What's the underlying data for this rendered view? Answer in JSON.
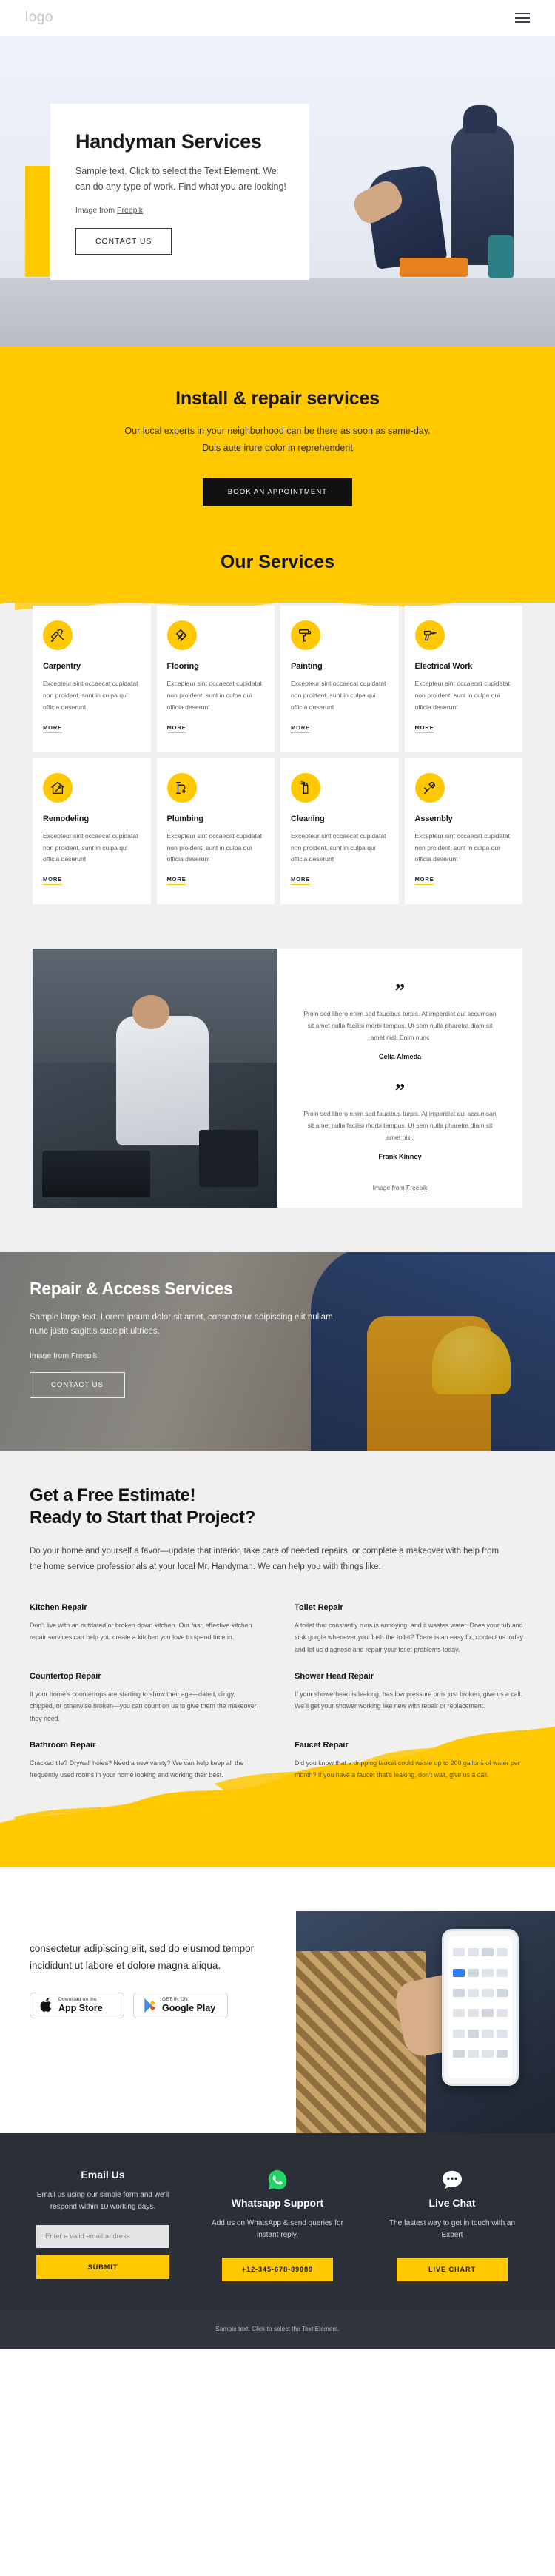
{
  "header": {
    "logo": "logo",
    "menu_icon": "hamburger-menu-icon"
  },
  "hero": {
    "title": "Handyman Services",
    "lead": "Sample text. Click to select the Text Element. We can do any type of work. Find what you are looking!",
    "credit_prefix": "Image from ",
    "credit_link": "Freepik",
    "cta": "CONTACT US"
  },
  "install": {
    "title": "Install & repair services",
    "text": "Our local experts in your neighborhood can be there as soon as same-day. Duis aute irure dolor in reprehenderit",
    "cta": "BOOK AN APPOINTMENT"
  },
  "services": {
    "title": "Our Services",
    "body": "Excepteur sint occaecat cupidatat non proident, sunt in culpa qui officia deserunt",
    "more": "MORE",
    "items": [
      {
        "title": "Carpentry",
        "icon": "saw-hammer-icon"
      },
      {
        "title": "Flooring",
        "icon": "parquet-floor-icon"
      },
      {
        "title": "Painting",
        "icon": "paint-roller-icon"
      },
      {
        "title": "Electrical Work",
        "icon": "power-drill-icon"
      },
      {
        "title": "Remodeling",
        "icon": "house-wrench-icon"
      },
      {
        "title": "Plumbing",
        "icon": "faucet-drip-icon"
      },
      {
        "title": "Cleaning",
        "icon": "spray-bottle-icon"
      },
      {
        "title": "Assembly",
        "icon": "screwdriver-wrench-icon"
      }
    ]
  },
  "testimonials": {
    "quote_mark": "”",
    "items": [
      {
        "text": "Proin sed libero enim sed faucibus turpis. At imperdiet dui accumsan sit amet nulla facilisi morbi tempus. Ut sem nulla pharetra diam sit amet nisl. Enim nunc",
        "author": "Celia Almeda"
      },
      {
        "text": "Proin sed libero enim sed faucibus turpis. At imperdiet dui accumsan sit amet nulla facilisi morbi tempus. Ut sem nulla pharetra diam sit amet nisl.",
        "author": "Frank Kinney"
      }
    ],
    "credit_prefix": "Image from ",
    "credit_link": "Freepik"
  },
  "repair": {
    "title": "Repair & Access Services",
    "text": "Sample large text. Lorem ipsum dolor sit amet, consectetur adipiscing elit nullam nunc justo sagittis suscipit ultrices.",
    "credit_prefix": "Image from ",
    "credit_link": "Freepik",
    "cta": "CONTACT US"
  },
  "estimate": {
    "title_line1": "Get a Free Estimate!",
    "title_line2": "Ready to Start that Project?",
    "intro": "Do your home and yourself a favor—update that interior, take care of needed repairs, or complete a makeover with help from the home service professionals at your local Mr. Handyman. We can help you with things like:",
    "items": [
      {
        "title": "Kitchen Repair",
        "text": "Don’t live with an outdated or broken down kitchen. Our fast, effective kitchen repair services can help you create a kitchen you love to spend time in."
      },
      {
        "title": "Toilet Repair",
        "text": "A toilet that constantly runs is annoying, and it wastes water. Does your tub and sink gurgle whenever you flush the toilet? There is an easy fix, contact us today and let us diagnose and repair your toilet problems today."
      },
      {
        "title": "Countertop Repair",
        "text": "If your home’s countertops are starting to show their age—dated, dingy, chipped, or otherwise broken—you can count on us to give them the makeover they need."
      },
      {
        "title": "Shower Head Repair",
        "text": "If your showerhead is leaking, has low pressure or is just broken, give us a call. We’ll get your shower working like new with repair or replacement."
      },
      {
        "title": "Bathroom Repair",
        "text": "Cracked tile? Drywall holes? Need a new vanity? We can help keep all the frequently used rooms in your home looking and working their best."
      },
      {
        "title": "Faucet Repair",
        "text": "Did you know that a dripping faucet could waste up to 200 gallons of water per month? If you have a faucet that’s leaking, don’t wait, give us a call."
      }
    ]
  },
  "app": {
    "text": "consectetur adipiscing elit, sed do eiusmod tempor incididunt ut labore et dolore magna aliqua.",
    "stores": [
      {
        "small": "Download on the",
        "big": "App Store",
        "icon": "apple-logo-icon"
      },
      {
        "small": "GET IN ON",
        "big": "Google Play",
        "icon": "google-play-icon"
      }
    ]
  },
  "footer": {
    "columns": [
      {
        "title": "Email Us",
        "text": "Email us using our simple form and we’ll respond within 10 working days.",
        "placeholder": "Enter a valid email address",
        "button": "SUBMIT",
        "icon": ""
      },
      {
        "title": "Whatsapp Support",
        "text": "Add us on WhatsApp & send queries for instant reply.",
        "button": "+12-345-678-89089",
        "icon": "whatsapp-icon"
      },
      {
        "title": "Live Chat",
        "text": "The fastest way to get in touch with an Expert",
        "button": "LIVE CHART",
        "icon": "chat-bubble-icon"
      }
    ],
    "bottom_text": "Sample text. Click to select the Text Element."
  },
  "colors": {
    "accent": "#ffc800",
    "dark": "#2b2f38",
    "whatsapp": "#25d366"
  }
}
